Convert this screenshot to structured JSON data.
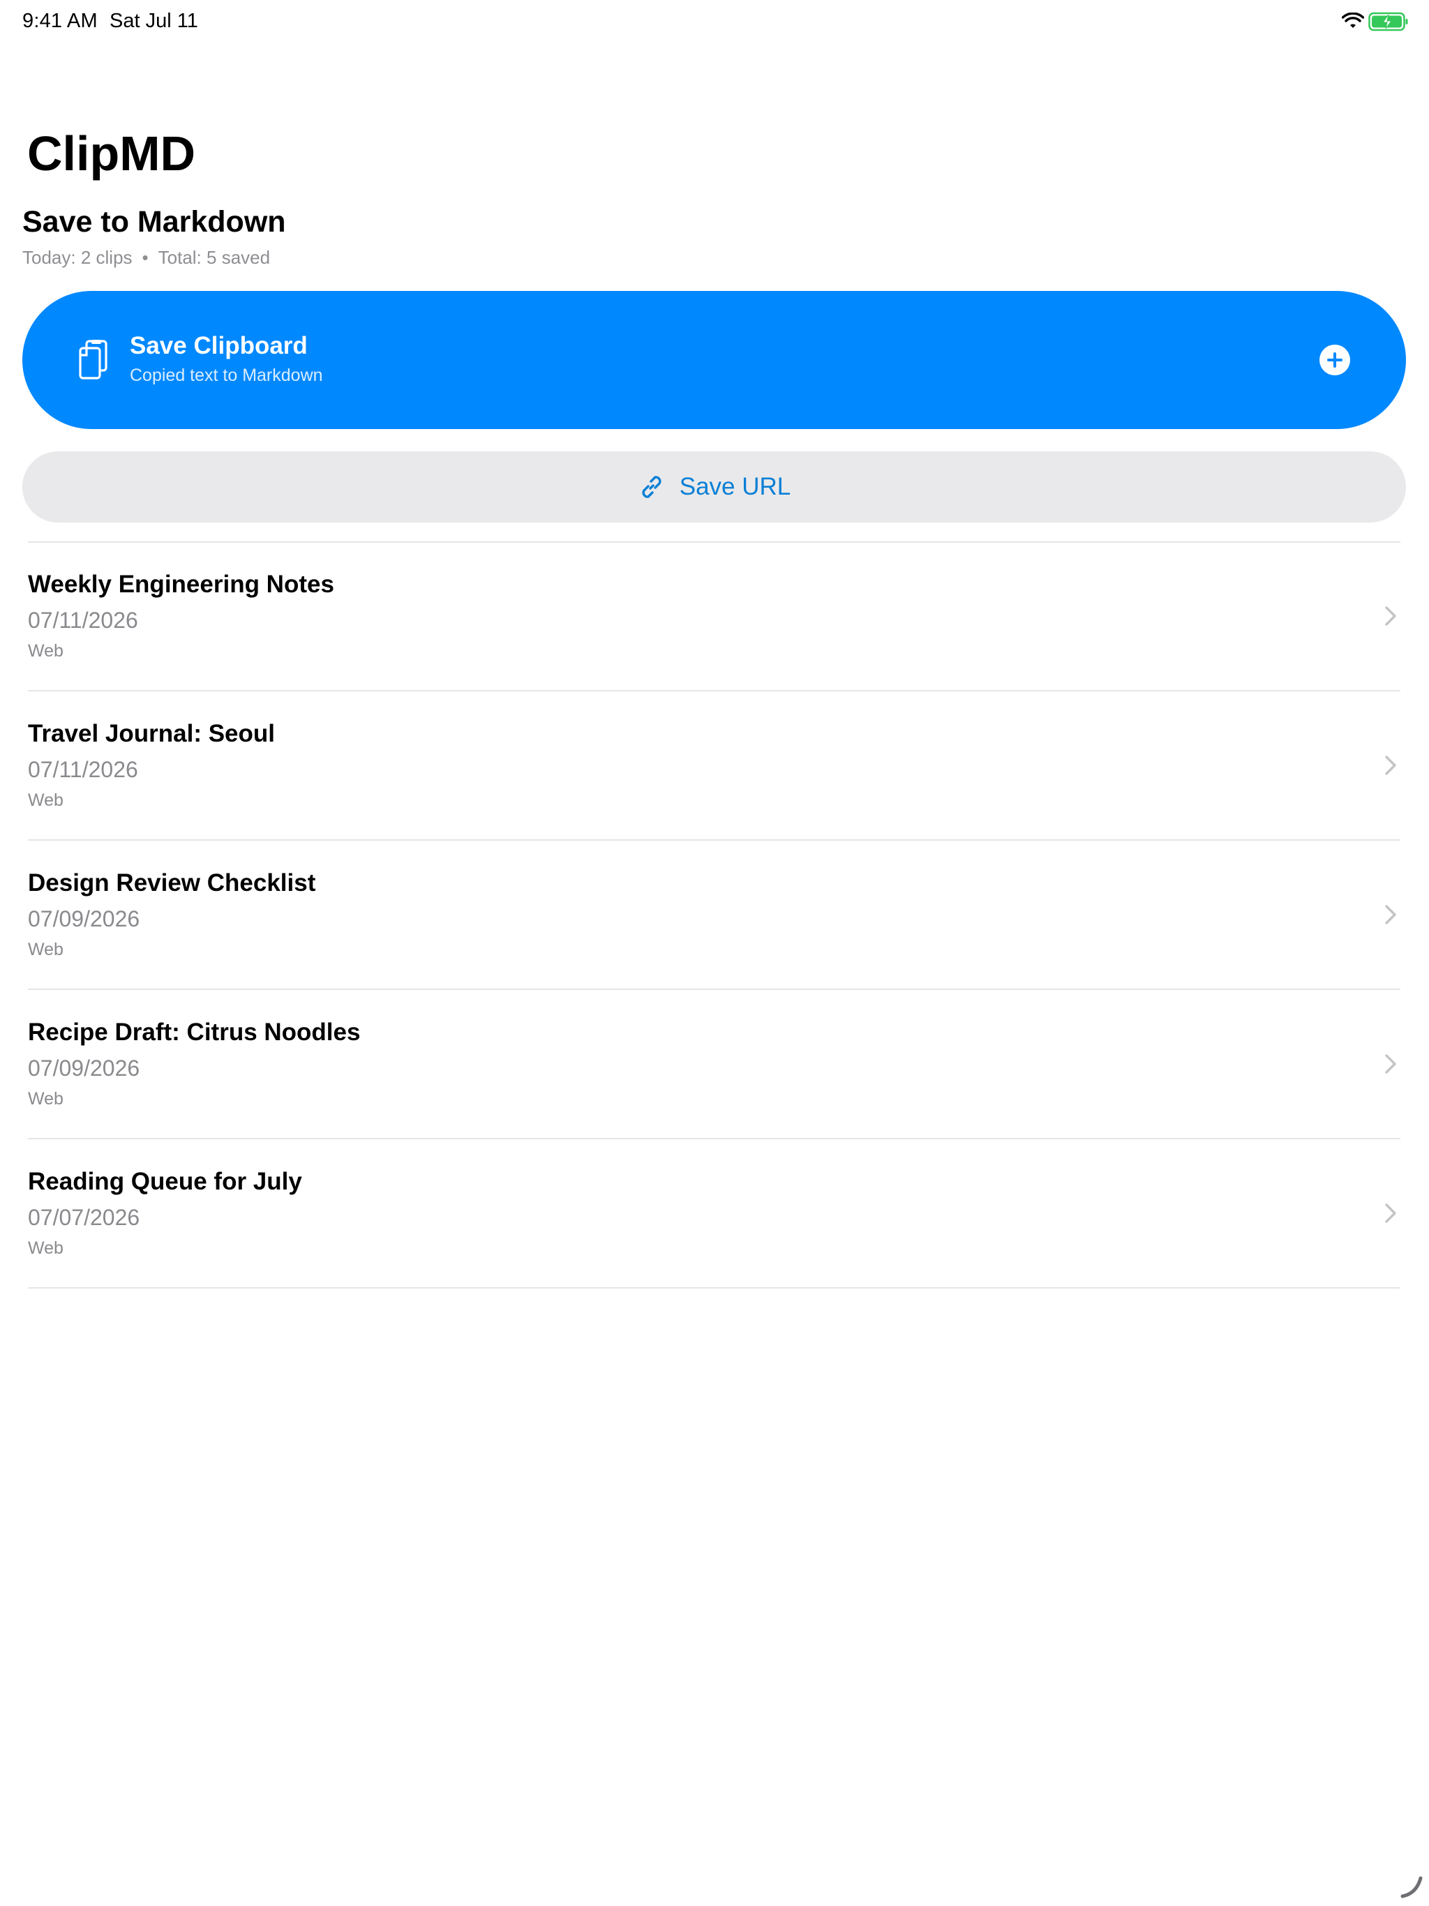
{
  "status_bar": {
    "time": "9:41 AM",
    "date": "Sat Jul 11",
    "wifi_icon": "wifi-icon",
    "battery_icon": "battery-charging-icon",
    "battery_color": "#34c759"
  },
  "app": {
    "title": "ClipMD"
  },
  "header": {
    "section_title": "Save to Markdown",
    "today_stat": "Today: 2 clips",
    "separator": "•",
    "total_stat": "Total: 5 saved"
  },
  "save_clipboard": {
    "title": "Save Clipboard",
    "subtitle": "Copied text to Markdown",
    "icon": "clipboard-icon",
    "action_icon": "plus-circle-icon",
    "color": "#0088ff"
  },
  "save_url": {
    "label": "Save URL",
    "icon": "link-icon",
    "color": "#0b7fd6"
  },
  "clips": [
    {
      "title": "Weekly Engineering Notes",
      "date": "07/11/2026",
      "source": "Web"
    },
    {
      "title": "Travel Journal: Seoul",
      "date": "07/11/2026",
      "source": "Web"
    },
    {
      "title": "Design Review Checklist",
      "date": "07/09/2026",
      "source": "Web"
    },
    {
      "title": "Recipe Draft: Citrus Noodles",
      "date": "07/09/2026",
      "source": "Web"
    },
    {
      "title": "Reading Queue for July",
      "date": "07/07/2026",
      "source": "Web"
    }
  ]
}
